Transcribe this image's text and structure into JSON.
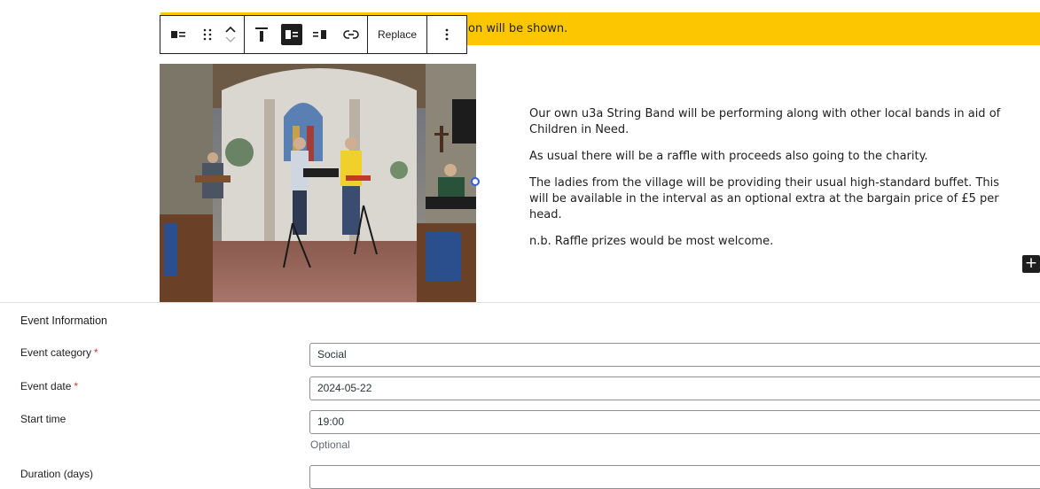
{
  "notice": {
    "text": "on will be shown."
  },
  "toolbar": {
    "icons": [
      "align-media-left-icon",
      "drag-handle-icon",
      "move-up-icon",
      "move-down-icon",
      "align-top-icon",
      "media-on-left-icon",
      "media-on-right-icon",
      "link-icon",
      "more-options-icon"
    ],
    "replace_label": "Replace"
  },
  "content": {
    "paragraphs": [
      "Our own u3a String Band will be performing along with other local bands in aid of Children in Need.",
      "As usual there will be a raffle with proceeds also going to the charity.",
      "The ladies from the village will be providing their usual high-standard buffet.  This will be available in the interval as an optional extra at the bargain price of £5 per head.",
      "n.b. Raffle prizes would be most welcome."
    ],
    "add_block_label": "+"
  },
  "event_info": {
    "title": "Event Information",
    "fields": [
      {
        "label": "Event category",
        "required_mark": "*",
        "value": "Social"
      },
      {
        "label": "Event date",
        "required_mark": "*",
        "value": "2024-05-22"
      },
      {
        "label": "Start time",
        "required_mark": "",
        "value": "19:00",
        "hint": "Optional"
      },
      {
        "label": "Duration (days)",
        "required_mark": "",
        "value": ""
      }
    ]
  },
  "colors": {
    "notice_bg": "#fcc700",
    "accent": "#3858e9",
    "required": "#d63638"
  }
}
